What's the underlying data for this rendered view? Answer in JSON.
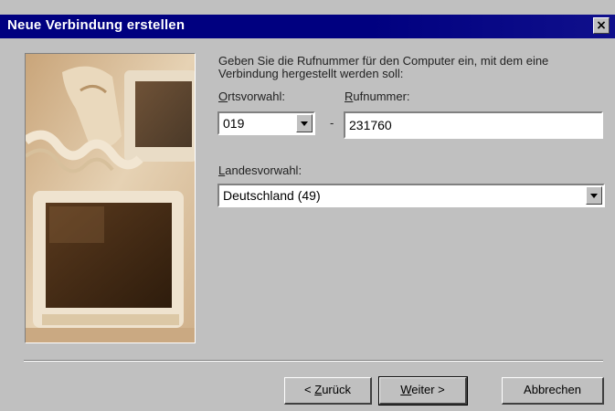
{
  "window": {
    "title": "Neue Verbindung erstellen",
    "close_glyph": "×"
  },
  "instructions": "Geben Sie die Rufnummer für den Computer ein, mit dem eine Verbindung hergestellt werden soll:",
  "area_code": {
    "label_mnemonic": "O",
    "label_rest": "rtsvorwahl:",
    "value": "019"
  },
  "dash": "-",
  "phone_number": {
    "label_mnemonic": "R",
    "label_rest": "ufnummer:",
    "value": "231760"
  },
  "country_code": {
    "label_mnemonic": "L",
    "label_rest": "andesvorwahl:",
    "value": "Deutschland (49)"
  },
  "buttons": {
    "back_prefix": "< ",
    "back_mnemonic": "Z",
    "back_rest": "urück",
    "next_mnemonic": "W",
    "next_rest": "eiter >",
    "cancel": "Abbrechen"
  },
  "icons": {
    "close": "close-icon",
    "dropdown": "chevron-down-icon",
    "illustration": "computer-photo"
  }
}
